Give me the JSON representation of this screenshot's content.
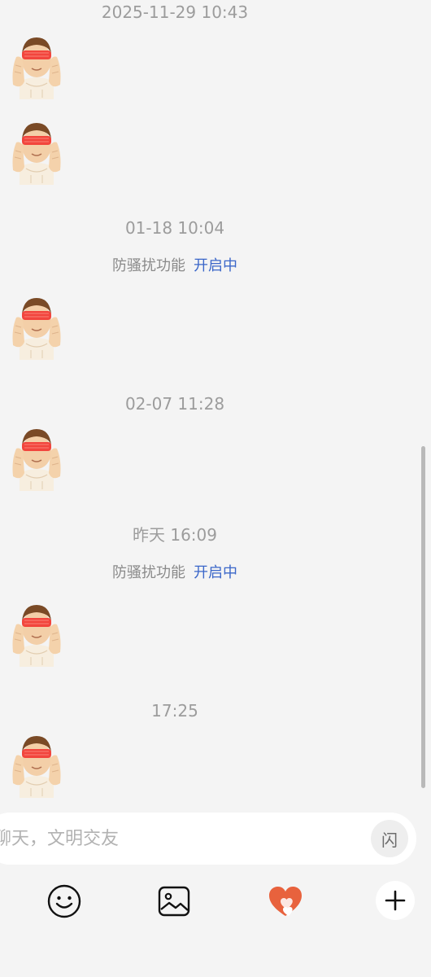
{
  "chat": {
    "timestamps": [
      "2025-11-29 10:43",
      "01-18 10:04",
      "02-07 11:28",
      "昨天 16:09",
      "17:25"
    ],
    "notices": [
      {
        "label": "防骚扰功能",
        "status": "开启中"
      },
      {
        "label": "防骚扰功能",
        "status": "开启中"
      }
    ],
    "stickers": [
      "hands-covering-eyes-sticker",
      "hands-covering-eyes-sticker",
      "hands-covering-eyes-sticker",
      "hands-covering-eyes-sticker",
      "hands-covering-eyes-sticker",
      "hands-covering-eyes-sticker"
    ]
  },
  "input": {
    "placeholder": "聊天，文明交友",
    "flash_label": "闪"
  },
  "toolbar": {
    "icons": [
      "smile-icon",
      "image-icon",
      "heart-icon",
      "plus-icon"
    ]
  },
  "colors": {
    "background": "#f4f4f4",
    "accent_blue": "#3b67c9",
    "heart": "#e8623d"
  }
}
